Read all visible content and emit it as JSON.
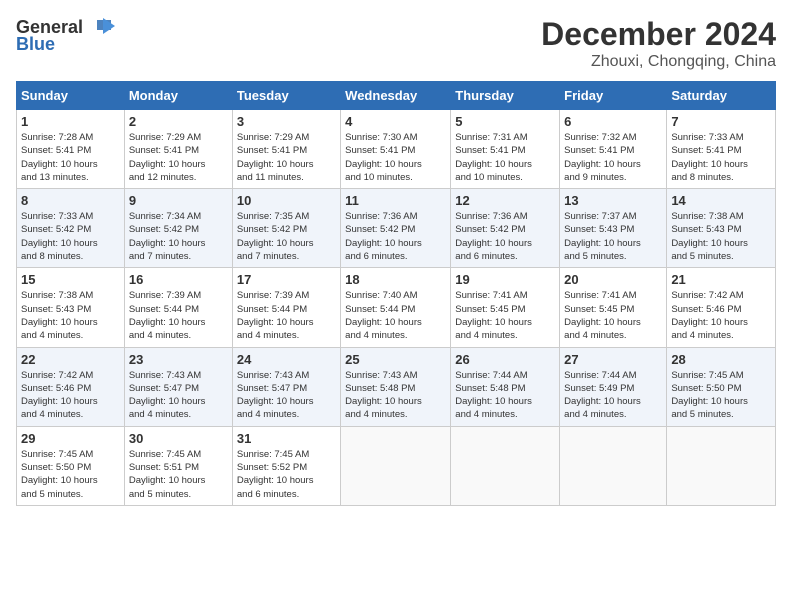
{
  "header": {
    "logo_general": "General",
    "logo_blue": "Blue",
    "month_title": "December 2024",
    "location": "Zhouxi, Chongqing, China"
  },
  "weekdays": [
    "Sunday",
    "Monday",
    "Tuesday",
    "Wednesday",
    "Thursday",
    "Friday",
    "Saturday"
  ],
  "weeks": [
    [
      {
        "day": "1",
        "sunrise": "7:28 AM",
        "sunset": "5:41 PM",
        "daylight": "10 hours and 13 minutes."
      },
      {
        "day": "2",
        "sunrise": "7:29 AM",
        "sunset": "5:41 PM",
        "daylight": "10 hours and 12 minutes."
      },
      {
        "day": "3",
        "sunrise": "7:29 AM",
        "sunset": "5:41 PM",
        "daylight": "10 hours and 11 minutes."
      },
      {
        "day": "4",
        "sunrise": "7:30 AM",
        "sunset": "5:41 PM",
        "daylight": "10 hours and 10 minutes."
      },
      {
        "day": "5",
        "sunrise": "7:31 AM",
        "sunset": "5:41 PM",
        "daylight": "10 hours and 10 minutes."
      },
      {
        "day": "6",
        "sunrise": "7:32 AM",
        "sunset": "5:41 PM",
        "daylight": "10 hours and 9 minutes."
      },
      {
        "day": "7",
        "sunrise": "7:33 AM",
        "sunset": "5:41 PM",
        "daylight": "10 hours and 8 minutes."
      }
    ],
    [
      {
        "day": "8",
        "sunrise": "7:33 AM",
        "sunset": "5:42 PM",
        "daylight": "10 hours and 8 minutes."
      },
      {
        "day": "9",
        "sunrise": "7:34 AM",
        "sunset": "5:42 PM",
        "daylight": "10 hours and 7 minutes."
      },
      {
        "day": "10",
        "sunrise": "7:35 AM",
        "sunset": "5:42 PM",
        "daylight": "10 hours and 7 minutes."
      },
      {
        "day": "11",
        "sunrise": "7:36 AM",
        "sunset": "5:42 PM",
        "daylight": "10 hours and 6 minutes."
      },
      {
        "day": "12",
        "sunrise": "7:36 AM",
        "sunset": "5:42 PM",
        "daylight": "10 hours and 6 minutes."
      },
      {
        "day": "13",
        "sunrise": "7:37 AM",
        "sunset": "5:43 PM",
        "daylight": "10 hours and 5 minutes."
      },
      {
        "day": "14",
        "sunrise": "7:38 AM",
        "sunset": "5:43 PM",
        "daylight": "10 hours and 5 minutes."
      }
    ],
    [
      {
        "day": "15",
        "sunrise": "7:38 AM",
        "sunset": "5:43 PM",
        "daylight": "10 hours and 4 minutes."
      },
      {
        "day": "16",
        "sunrise": "7:39 AM",
        "sunset": "5:44 PM",
        "daylight": "10 hours and 4 minutes."
      },
      {
        "day": "17",
        "sunrise": "7:39 AM",
        "sunset": "5:44 PM",
        "daylight": "10 hours and 4 minutes."
      },
      {
        "day": "18",
        "sunrise": "7:40 AM",
        "sunset": "5:44 PM",
        "daylight": "10 hours and 4 minutes."
      },
      {
        "day": "19",
        "sunrise": "7:41 AM",
        "sunset": "5:45 PM",
        "daylight": "10 hours and 4 minutes."
      },
      {
        "day": "20",
        "sunrise": "7:41 AM",
        "sunset": "5:45 PM",
        "daylight": "10 hours and 4 minutes."
      },
      {
        "day": "21",
        "sunrise": "7:42 AM",
        "sunset": "5:46 PM",
        "daylight": "10 hours and 4 minutes."
      }
    ],
    [
      {
        "day": "22",
        "sunrise": "7:42 AM",
        "sunset": "5:46 PM",
        "daylight": "10 hours and 4 minutes."
      },
      {
        "day": "23",
        "sunrise": "7:43 AM",
        "sunset": "5:47 PM",
        "daylight": "10 hours and 4 minutes."
      },
      {
        "day": "24",
        "sunrise": "7:43 AM",
        "sunset": "5:47 PM",
        "daylight": "10 hours and 4 minutes."
      },
      {
        "day": "25",
        "sunrise": "7:43 AM",
        "sunset": "5:48 PM",
        "daylight": "10 hours and 4 minutes."
      },
      {
        "day": "26",
        "sunrise": "7:44 AM",
        "sunset": "5:48 PM",
        "daylight": "10 hours and 4 minutes."
      },
      {
        "day": "27",
        "sunrise": "7:44 AM",
        "sunset": "5:49 PM",
        "daylight": "10 hours and 4 minutes."
      },
      {
        "day": "28",
        "sunrise": "7:45 AM",
        "sunset": "5:50 PM",
        "daylight": "10 hours and 5 minutes."
      }
    ],
    [
      {
        "day": "29",
        "sunrise": "7:45 AM",
        "sunset": "5:50 PM",
        "daylight": "10 hours and 5 minutes."
      },
      {
        "day": "30",
        "sunrise": "7:45 AM",
        "sunset": "5:51 PM",
        "daylight": "10 hours and 5 minutes."
      },
      {
        "day": "31",
        "sunrise": "7:45 AM",
        "sunset": "5:52 PM",
        "daylight": "10 hours and 6 minutes."
      },
      null,
      null,
      null,
      null
    ]
  ],
  "labels": {
    "sunrise": "Sunrise:",
    "sunset": "Sunset:",
    "daylight": "Daylight:"
  }
}
